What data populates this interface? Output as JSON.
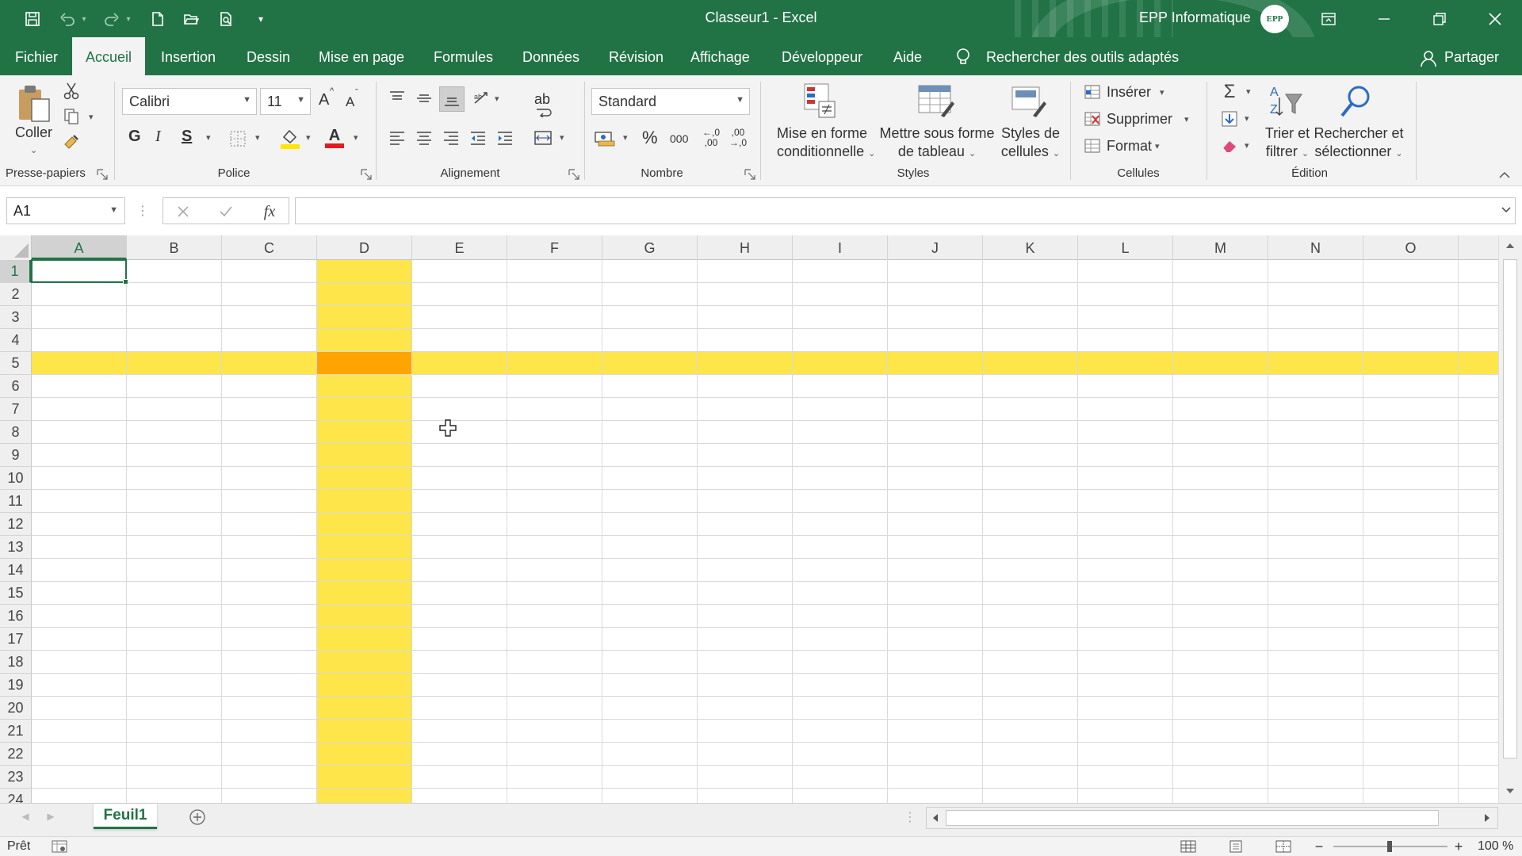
{
  "window": {
    "title": "Classeur1  -  Excel",
    "account_name": "EPP Informatique",
    "avatar_text": "EPP"
  },
  "quick_access": {
    "icons": [
      "save-icon",
      "undo-icon",
      "redo-icon",
      "new-file-icon",
      "open-icon",
      "print-preview-icon",
      "customize-icon"
    ]
  },
  "tabs": [
    "Fichier",
    "Accueil",
    "Insertion",
    "Dessin",
    "Mise en page",
    "Formules",
    "Données",
    "Révision",
    "Affichage",
    "Développeur",
    "Aide"
  ],
  "active_tab": "Accueil",
  "tell_me": "Rechercher des outils adaptés",
  "share_label": "Partager",
  "ribbon": {
    "clipboard": {
      "group_label": "Presse-papiers",
      "paste_label": "Coller"
    },
    "font": {
      "group_label": "Police",
      "font_name": "Calibri",
      "font_size": "11",
      "grow": "A",
      "shrink": "A",
      "bold": "G",
      "italic": "I",
      "underline": "S",
      "font_color_letter": "A",
      "highlight_color": "#ffe600",
      "font_color": "#e11b22"
    },
    "alignment": {
      "group_label": "Alignement",
      "wrap_label": "ab"
    },
    "number": {
      "group_label": "Nombre",
      "format": "Standard",
      "percent": "%",
      "thousands": "000",
      "inc_decimal_top": "←,0",
      "inc_decimal_bottom": ",00",
      "dec_decimal_top": ",00",
      "dec_decimal_bottom": "→,0"
    },
    "styles": {
      "group_label": "Styles",
      "conditional_line1": "Mise en forme",
      "conditional_line2": "conditionnelle",
      "table_line1": "Mettre sous forme",
      "table_line2": "de tableau",
      "cell_styles_line1": "Styles de",
      "cell_styles_line2": "cellules"
    },
    "cells": {
      "group_label": "Cellules",
      "insert": "Insérer",
      "delete": "Supprimer",
      "format": "Format"
    },
    "editing": {
      "group_label": "Édition",
      "sort_line1": "Trier et",
      "sort_line2": "filtrer",
      "find_line1": "Rechercher et",
      "find_line2": "sélectionner"
    }
  },
  "formula_bar": {
    "name_box": "A1",
    "fx": "fx",
    "cancel_icon": "close-icon",
    "enter_icon": "check-icon",
    "content": ""
  },
  "sheet": {
    "columns": [
      "A",
      "B",
      "C",
      "D",
      "E",
      "F",
      "G",
      "H",
      "I",
      "J",
      "K",
      "L",
      "M",
      "N",
      "O"
    ],
    "rows": [
      "1",
      "2",
      "3",
      "4",
      "5",
      "6",
      "7",
      "8",
      "9",
      "10",
      "11",
      "12",
      "13",
      "14",
      "15",
      "16",
      "17",
      "18",
      "19",
      "20",
      "21",
      "22",
      "23",
      "24"
    ],
    "active_cell": "A1",
    "highlighted_column": "D",
    "highlighted_row": "5",
    "highlight_color": "#fee54a",
    "intersection_color": "#ffa400"
  },
  "sheet_tabs": [
    "Feuil1"
  ],
  "status": {
    "ready": "Prêt",
    "zoom": "100 %"
  }
}
